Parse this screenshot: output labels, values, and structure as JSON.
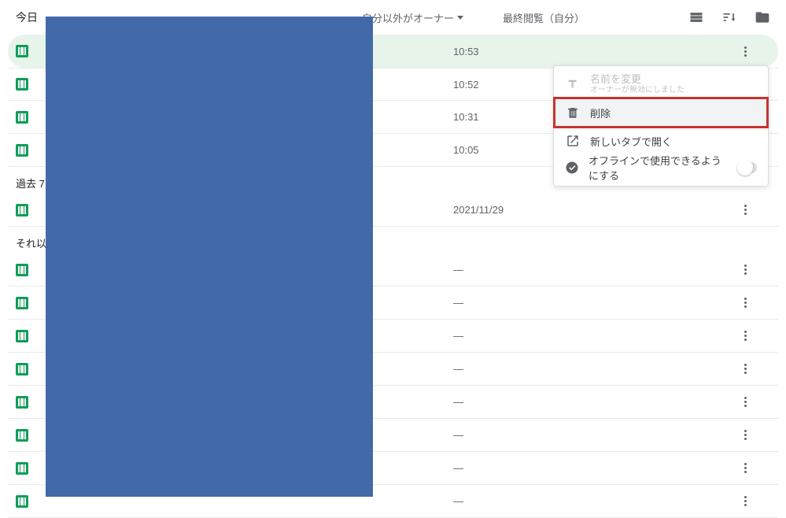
{
  "header": {
    "section_today": "今日",
    "owner_filter": "自分以外がオーナー",
    "sort_label": "最終閲覧（自分）"
  },
  "sections": {
    "today": "今日",
    "past7": "過去 7",
    "earlier": "それ以"
  },
  "rows": {
    "today": [
      {
        "time": "10:53"
      },
      {
        "time": "10:52"
      },
      {
        "time": "10:31"
      },
      {
        "time": "10:05"
      }
    ],
    "past7": [
      {
        "time": "2021/11/29"
      }
    ],
    "earlier": [
      {
        "time": "—"
      },
      {
        "time": "—"
      },
      {
        "time": "—"
      },
      {
        "time": "—"
      },
      {
        "time": "—"
      },
      {
        "time": "—"
      },
      {
        "time": "—"
      },
      {
        "time": "—"
      }
    ]
  },
  "menu": {
    "rename": "名前を変更",
    "rename_note": "オーナーが無効にしました",
    "delete": "削除",
    "open_new_tab": "新しいタブで開く",
    "offline": "オフラインで使用できるようにする"
  }
}
